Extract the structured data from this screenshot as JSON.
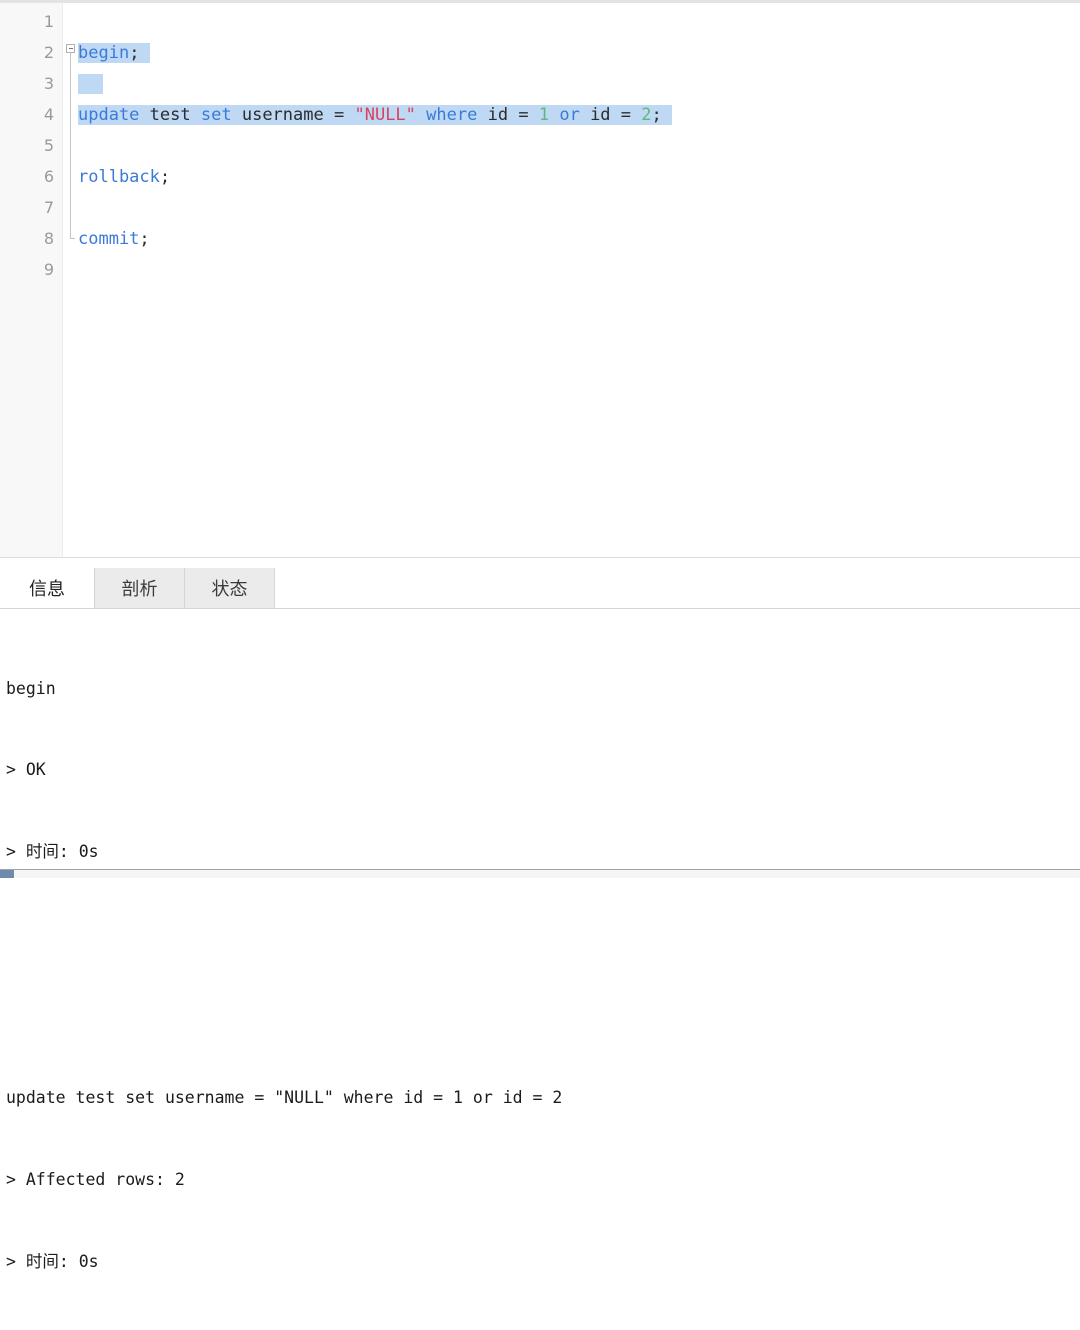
{
  "editor": {
    "line_numbers": [
      "1",
      "2",
      "3",
      "4",
      "5",
      "6",
      "7",
      "8",
      "9"
    ],
    "fold_marker": "fold-collapse-box",
    "lines": [
      {
        "n": "1",
        "tokens": []
      },
      {
        "n": "2",
        "selected": true,
        "tokens": [
          {
            "t": "begin",
            "c": "kw"
          },
          {
            "t": ";",
            "c": "punc"
          }
        ]
      },
      {
        "n": "3",
        "selected": true,
        "tokens": []
      },
      {
        "n": "4",
        "selected": true,
        "tokens": [
          {
            "t": "update",
            "c": "kw"
          },
          {
            "t": " ",
            "c": "op"
          },
          {
            "t": "test",
            "c": "ident"
          },
          {
            "t": " ",
            "c": "op"
          },
          {
            "t": "set",
            "c": "kw"
          },
          {
            "t": " ",
            "c": "op"
          },
          {
            "t": "username",
            "c": "ident"
          },
          {
            "t": " ",
            "c": "op"
          },
          {
            "t": "=",
            "c": "op"
          },
          {
            "t": " ",
            "c": "op"
          },
          {
            "t": "\"NULL\"",
            "c": "str"
          },
          {
            "t": " ",
            "c": "op"
          },
          {
            "t": "where",
            "c": "kw"
          },
          {
            "t": " ",
            "c": "op"
          },
          {
            "t": "id",
            "c": "ident"
          },
          {
            "t": " ",
            "c": "op"
          },
          {
            "t": "=",
            "c": "op"
          },
          {
            "t": " ",
            "c": "op"
          },
          {
            "t": "1",
            "c": "num"
          },
          {
            "t": " ",
            "c": "op"
          },
          {
            "t": "or",
            "c": "kw"
          },
          {
            "t": " ",
            "c": "op"
          },
          {
            "t": "id",
            "c": "ident"
          },
          {
            "t": " ",
            "c": "op"
          },
          {
            "t": "=",
            "c": "op"
          },
          {
            "t": " ",
            "c": "op"
          },
          {
            "t": "2",
            "c": "num"
          },
          {
            "t": ";",
            "c": "punc"
          }
        ]
      },
      {
        "n": "5",
        "tokens": []
      },
      {
        "n": "6",
        "tokens": [
          {
            "t": "rollback",
            "c": "kw"
          },
          {
            "t": ";",
            "c": "punc"
          }
        ]
      },
      {
        "n": "7",
        "tokens": []
      },
      {
        "n": "8",
        "tokens": [
          {
            "t": "commit",
            "c": "kw"
          },
          {
            "t": ";",
            "c": "punc"
          }
        ]
      },
      {
        "n": "9",
        "tokens": []
      }
    ],
    "plain_text": {
      "line2": "begin;",
      "line4": "update test set username = \"NULL\" where id = 1 or id = 2;",
      "line6": "rollback;",
      "line8": "commit;"
    }
  },
  "results": {
    "tabs": [
      {
        "label": "信息",
        "active": true
      },
      {
        "label": "剖析",
        "active": false
      },
      {
        "label": "状态",
        "active": false
      }
    ],
    "log_lines": [
      "begin",
      "> OK",
      "> 时间: 0s",
      "",
      "",
      "update test set username = \"NULL\" where id = 1 or id = 2",
      "> Affected rows: 2",
      "> 时间: 0s"
    ]
  },
  "colors": {
    "keyword": "#3a7ad8",
    "identifier": "#2b2b2b",
    "string": "#d9435f",
    "number": "#5cb87a",
    "selection": "#bfd9f5",
    "gutter_bg": "#f8f8f8",
    "gutter_text": "#9a9a9a",
    "tab_inactive_bg": "#ebebeb",
    "log_text": "#1b1b1b"
  }
}
